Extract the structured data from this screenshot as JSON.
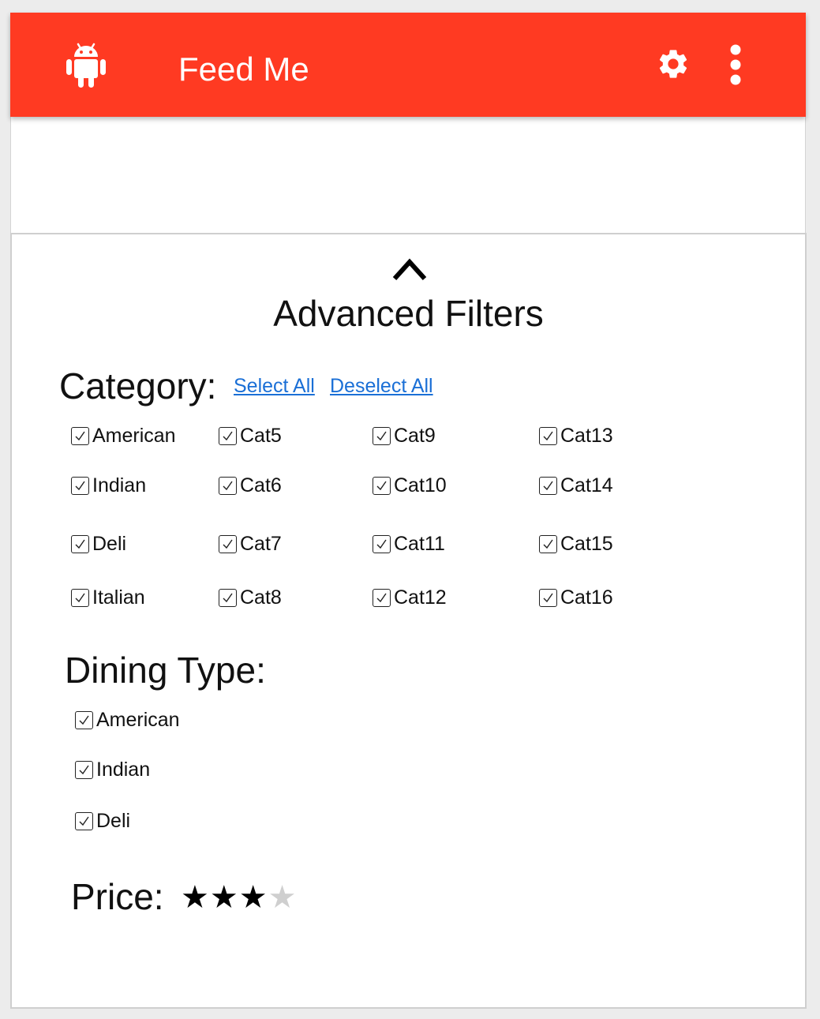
{
  "app": {
    "title": "Feed Me",
    "brand_color": "#ff3a22",
    "icons": [
      "android-icon",
      "gear-icon",
      "more-vert-icon"
    ]
  },
  "filters": {
    "title": "Advanced Filters",
    "collapse_icon": "chevron-up-icon",
    "category": {
      "label": "Category:",
      "select_all": "Select All",
      "deselect_all": "Deselect All",
      "items": [
        {
          "label": "American",
          "checked": true
        },
        {
          "label": "Indian",
          "checked": true
        },
        {
          "label": "Deli",
          "checked": true
        },
        {
          "label": "Italian",
          "checked": true
        },
        {
          "label": "Cat5",
          "checked": true
        },
        {
          "label": "Cat6",
          "checked": true
        },
        {
          "label": "Cat7",
          "checked": true
        },
        {
          "label": "Cat8",
          "checked": true
        },
        {
          "label": "Cat9",
          "checked": true
        },
        {
          "label": "Cat10",
          "checked": true
        },
        {
          "label": "Cat11",
          "checked": true
        },
        {
          "label": "Cat12",
          "checked": true
        },
        {
          "label": "Cat13",
          "checked": true
        },
        {
          "label": "Cat14",
          "checked": true
        },
        {
          "label": "Cat15",
          "checked": true
        },
        {
          "label": "Cat16",
          "checked": true
        }
      ]
    },
    "dining_type": {
      "label": "Dining Type:",
      "items": [
        {
          "label": "American",
          "checked": true
        },
        {
          "label": "Indian",
          "checked": true
        },
        {
          "label": "Deli",
          "checked": true
        }
      ]
    },
    "price": {
      "label": "Price:",
      "rating": 3,
      "max": 4,
      "filled_color": "#000000",
      "empty_color": "#cfcfcf"
    }
  }
}
